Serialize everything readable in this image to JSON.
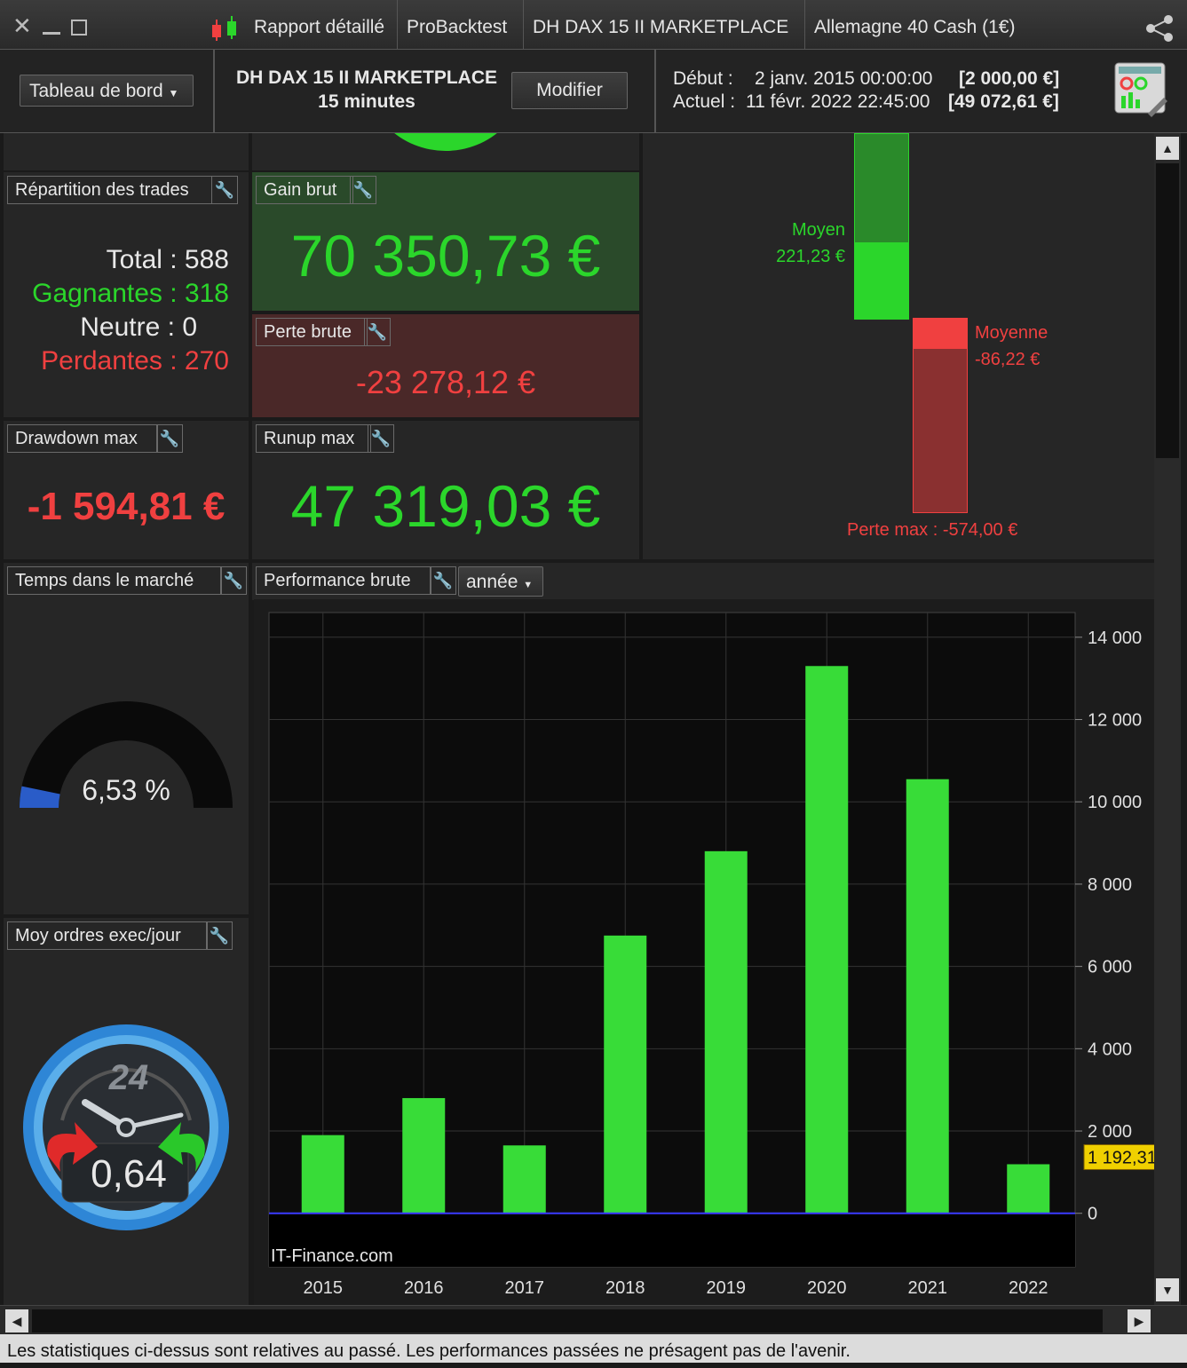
{
  "titlebar": {
    "tabs": [
      "Rapport détaillé",
      "ProBacktest",
      "DH DAX 15 II MARKETPLACE",
      "Allemagne 40 Cash (1€)"
    ]
  },
  "header": {
    "dashboard_label": "Tableau de bord",
    "strategy_name": "DH DAX 15 II MARKETPLACE",
    "timeframe": "15 minutes",
    "modify_label": "Modifier",
    "start_label": "Début :",
    "start_date": "2 janv. 2015 00:00:00",
    "start_value": "[2 000,00 €]",
    "current_label": "Actuel :",
    "current_date": "11 févr. 2022 22:45:00",
    "current_value": "[49 072,61 €]"
  },
  "repartition": {
    "title": "Répartition des trades",
    "total": "Total : 588",
    "gagnantes": "Gagnantes : 318",
    "neutre": "Neutre : 0",
    "perdantes": "Perdantes : 270"
  },
  "gain_brut": {
    "title": "Gain brut",
    "value": "70 350,73 €"
  },
  "perte_brute": {
    "title": "Perte brute",
    "value": "-23 278,12 €"
  },
  "drawdown": {
    "title": "Drawdown max",
    "value": "-1 594,81 €"
  },
  "runup": {
    "title": "Runup max",
    "value": "47 319,03 €"
  },
  "gain_perte": {
    "moyen_label": "Moyen",
    "moyen_value": "221,23 €",
    "moyenne_label": "Moyenne",
    "moyenne_value": "-86,22 €",
    "perte_max": "Perte max : -574,00 €"
  },
  "temps_marche": {
    "title": "Temps dans le marché",
    "value": "6,53 %",
    "fraction": 0.0653
  },
  "moy_ordres": {
    "title": "Moy ordres exec/jour",
    "value": "0,64",
    "clock_label": "24"
  },
  "performance": {
    "title": "Performance brute",
    "period": "année"
  },
  "chart_data": {
    "type": "bar",
    "categories": [
      "2015",
      "2016",
      "2017",
      "2018",
      "2019",
      "2020",
      "2021",
      "2022"
    ],
    "values": [
      1900,
      2800,
      1650,
      6750,
      8800,
      13300,
      10550,
      1192.31
    ],
    "y_ticks": [
      "14 000",
      "12 000",
      "10 000",
      "8 000",
      "6 000",
      "4 000",
      "2 000",
      "0"
    ],
    "ylim": [
      -1300,
      14600
    ],
    "last_value_label": "1 192,31",
    "watermark": "IT-Finance.com",
    "bar_color": "#38dc38"
  },
  "footer": "Les statistiques ci-dessus sont relatives au passé. Les performances passées ne présagent pas de l'avenir."
}
